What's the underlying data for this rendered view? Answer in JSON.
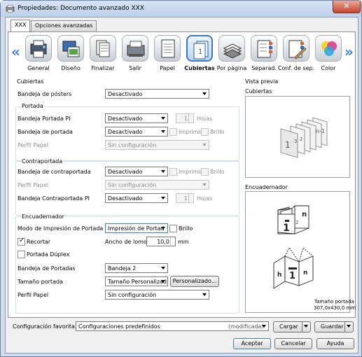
{
  "window": {
    "title": "Propiedades: Documento avanzado XXX"
  },
  "tabs": [
    "XXX",
    "Opciones avanzadas"
  ],
  "ribbon": {
    "items": [
      {
        "label": "General",
        "icon": "general-icon"
      },
      {
        "label": "Diseño",
        "icon": "layout-icon"
      },
      {
        "label": "Finalizar",
        "icon": "finishing-icon"
      },
      {
        "label": "Salir",
        "icon": "output-icon"
      },
      {
        "label": "Papel",
        "icon": "paper-icon"
      },
      {
        "label": "Cubiertas",
        "icon": "cover-icon",
        "selected": true
      },
      {
        "label": "Por página",
        "icon": "per-page-icon"
      },
      {
        "label": "Separad.",
        "icon": "separator-icon"
      },
      {
        "label": "Conf. de sep.",
        "icon": "separator-settings-icon"
      },
      {
        "label": "Color",
        "icon": "color-icon"
      }
    ]
  },
  "covers": {
    "heading": "Cubiertas",
    "poster_tray_label": "Bandeja de pósters",
    "poster_tray_value": "Desactivado",
    "front": {
      "heading": "Portada",
      "pi_label": "Bandeja Portada PI",
      "pi_value": "Desactivado",
      "pi_count": "1",
      "pi_units": "Hojas",
      "tray_label": "Bandeja de portada",
      "tray_value": "Desactivado",
      "print_label": "Imprimir",
      "gloss_label": "Brillo",
      "profile_label": "Perfil Papel",
      "profile_value": "Sin configuración"
    },
    "back": {
      "heading": "Contraportada",
      "tray_label": "Bandeja de contraportada",
      "tray_value": "Desactivado",
      "print_label": "Imprimir",
      "gloss_label": "Brillo",
      "profile_label": "Perfil Papel",
      "profile_value": "Sin configuración",
      "pi_label": "Bandeja Contraportada PI",
      "pi_value": "Desactivado",
      "pi_count": "1",
      "pi_units": "Hojas"
    },
    "binder": {
      "heading": "Encuadernador",
      "print_mode_label": "Modo de Impresión de Portada",
      "print_mode_value": "Impresión de Portad",
      "gloss_label": "Brillo",
      "trim_label": "Recortar",
      "spine_label": "Ancho de lomo",
      "spine_value": "10,0",
      "spine_unit": "mm",
      "duplex_label": "Portada Dúplex",
      "tray_label": "Bandeja de Portadas",
      "tray_value": "Bandeja 2",
      "size_label": "Tamaño portada",
      "size_value": "Tamaño Personalizad",
      "size_button": "Personalizado...",
      "profile_label": "Perfil Papel",
      "profile_value": "Sin configuración"
    }
  },
  "preview": {
    "heading": "Vista previa",
    "covers_label": "Cubiertas",
    "binder_label": "Encuadernador",
    "size_caption_1": "Tamaño portada",
    "size_caption_2": "307,0x430,0 mm",
    "glyphs": {
      "n1": "n-1",
      "one": "1",
      "two": "2",
      "three": "3",
      "n": "n",
      "h": "h"
    }
  },
  "favorites": {
    "label": "Configuración favorita",
    "value": "Configuraciones predefinidos",
    "modified": "(modificada)",
    "load": "Cargar",
    "save": "Guardar"
  },
  "buttons": {
    "ok": "Aceptar",
    "cancel": "Cancelar",
    "help": "Ayuda"
  },
  "colors": {
    "accent": "#3b78c6",
    "titlebar": "#c9d9ee",
    "close": "#c6452d"
  }
}
